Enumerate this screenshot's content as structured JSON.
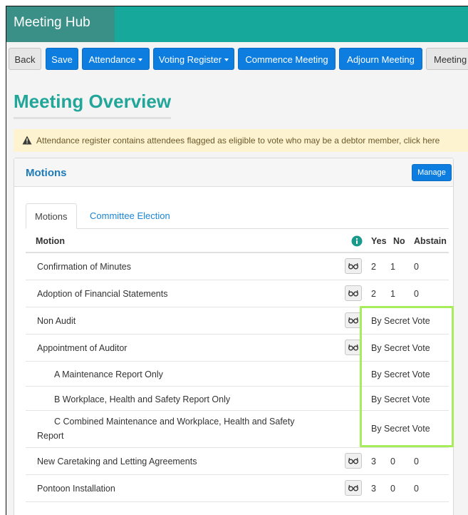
{
  "app": {
    "title": "Meeting Hub"
  },
  "toolbar": {
    "back": "Back",
    "save": "Save",
    "attendance": "Attendance",
    "voting_register": "Voting Register",
    "commence": "Commence Meeting",
    "adjourn": "Adjourn Meeting",
    "meeting": "Meeting I"
  },
  "page": {
    "title": "Meeting Overview"
  },
  "alert": {
    "text": "Attendance register contains attendees flagged as eligible to vote who may be a debtor member, click here"
  },
  "panel": {
    "title": "Motions",
    "manage": "Manage"
  },
  "tabs": {
    "motions": "Motions",
    "committee": "Committee Election"
  },
  "table": {
    "headers": {
      "motion": "Motion",
      "yes": "Yes",
      "no": "No",
      "abstain": "Abstain"
    },
    "rows": [
      {
        "motion": "Confirmation of Minutes",
        "yes": "2",
        "no": "1",
        "abstain": "0"
      },
      {
        "motion": "Adoption of Financial Statements",
        "yes": "2",
        "no": "1",
        "abstain": "0"
      },
      {
        "motion": "Non Audit",
        "result": "By Secret Vote"
      },
      {
        "motion": "Appointment of Auditor",
        "result": "By Secret Vote"
      },
      {
        "motion": "A Maintenance Report Only",
        "result": "By Secret Vote"
      },
      {
        "motion": "B Workplace, Health and Safety Report Only",
        "result": "By Secret Vote"
      },
      {
        "motion_line1": "C Combined Maintenance and Workplace, Health and Safety",
        "motion_line2": "Report",
        "result": "By Secret Vote"
      },
      {
        "motion": "New Caretaking and Letting Agreements",
        "yes": "3",
        "no": "0",
        "abstain": "0"
      },
      {
        "motion": "Pontoon Installation",
        "yes": "3",
        "no": "0",
        "abstain": "0"
      }
    ]
  },
  "colors": {
    "brand": "#16a89a",
    "primary": "#0d7ee0",
    "title": "#22a69a",
    "highlight": "#a7ec5a"
  },
  "icons": {
    "view": "glasses-icon",
    "info": "info-icon",
    "warning": "warning-icon"
  }
}
